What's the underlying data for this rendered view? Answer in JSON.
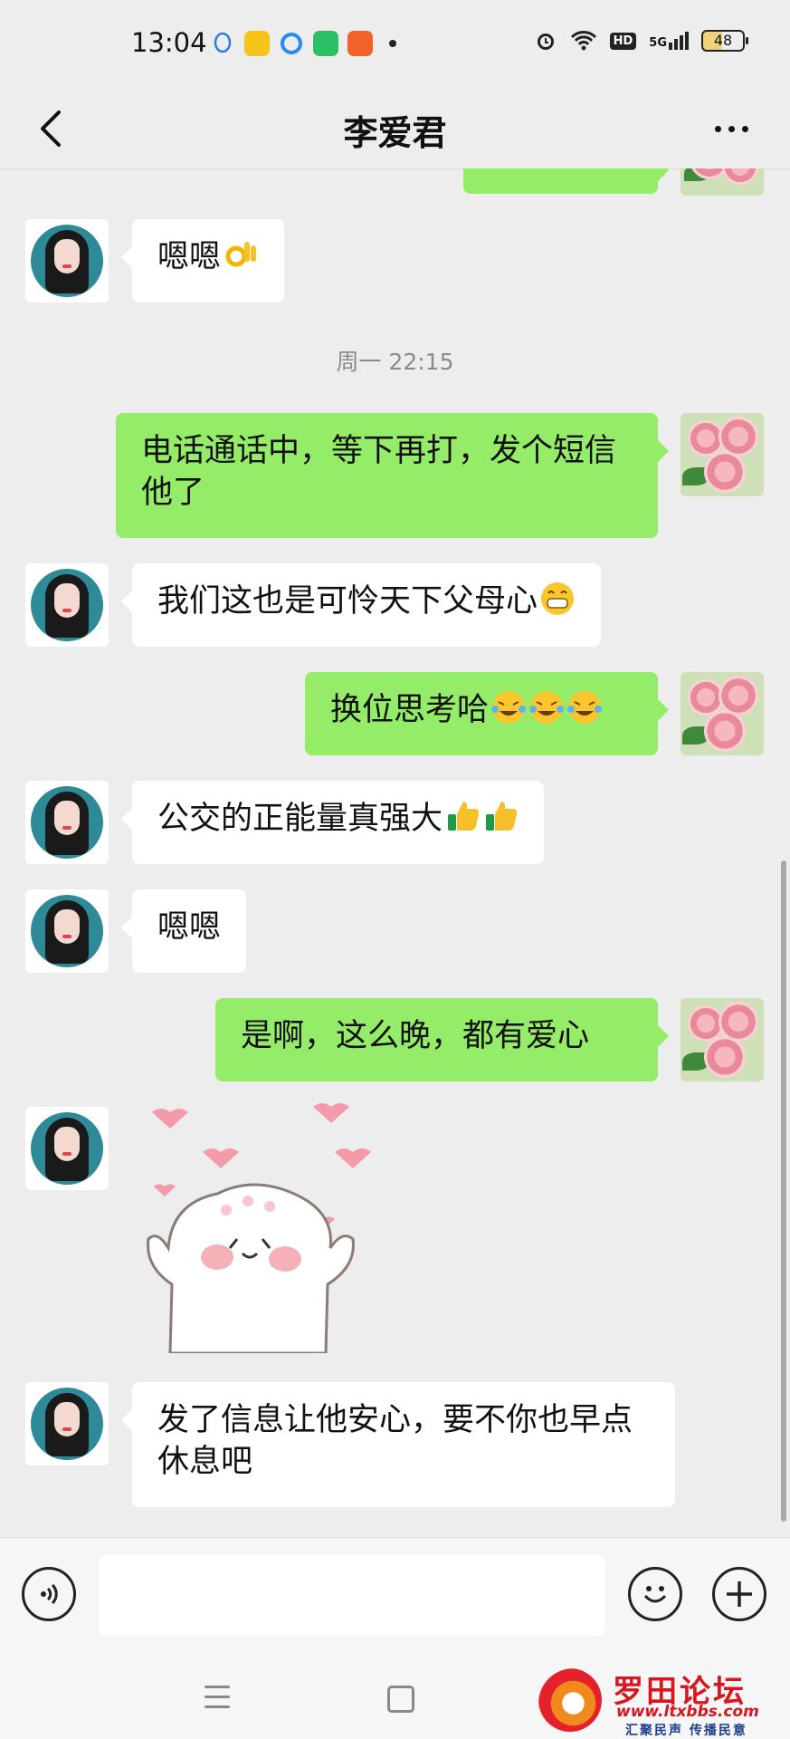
{
  "status_bar": {
    "time": "13:04",
    "network": "5G",
    "hd": "HD",
    "battery": "48",
    "icons": [
      "qq-icon",
      "wallet-icon",
      "browser-icon",
      "message-icon",
      "news-app-icon",
      "alarm-icon",
      "wifi-icon",
      "signal-icon"
    ]
  },
  "header": {
    "title": "李爱君",
    "back_icon": "chevron-left-icon",
    "more_icon": "ellipsis-icon"
  },
  "messages": [
    {
      "side": "out",
      "text": "",
      "partial": true
    },
    {
      "side": "in",
      "text": "嗯嗯",
      "emoji": [
        "ok-hand"
      ]
    },
    {
      "type": "time",
      "text": "周一 22:15"
    },
    {
      "side": "out",
      "text": "电话通话中，等下再打，发个短信他了"
    },
    {
      "side": "in",
      "text": "我们这也是可怜天下父母心",
      "emoji": [
        "grin"
      ]
    },
    {
      "side": "out",
      "text": "换位思考哈",
      "emoji": [
        "laugh-cry",
        "laugh-cry",
        "laugh-cry"
      ]
    },
    {
      "side": "in",
      "text": "公交的正能量真强大",
      "emoji": [
        "thumbs-up",
        "thumbs-up"
      ]
    },
    {
      "side": "in",
      "text": "嗯嗯"
    },
    {
      "side": "out",
      "text": "是啊，这么晚，都有爱心"
    },
    {
      "side": "in",
      "type": "sticker",
      "sticker": "love-bun-sticker"
    },
    {
      "side": "in",
      "text": "发了信息让他安心，要不你也早点休息吧"
    }
  ],
  "input_bar": {
    "voice_icon": "voice-icon",
    "placeholder": "",
    "emoji_icon": "smiley-icon",
    "add_icon": "plus-icon"
  },
  "watermark": {
    "name": "罗田论坛",
    "url": "www.ltxbbs.com",
    "slogan": "汇聚民声 传播民意"
  },
  "colors": {
    "background": "#ededed",
    "bubble_out": "#95ec69",
    "bubble_in": "#ffffff",
    "watermark_red": "#d8161f"
  }
}
